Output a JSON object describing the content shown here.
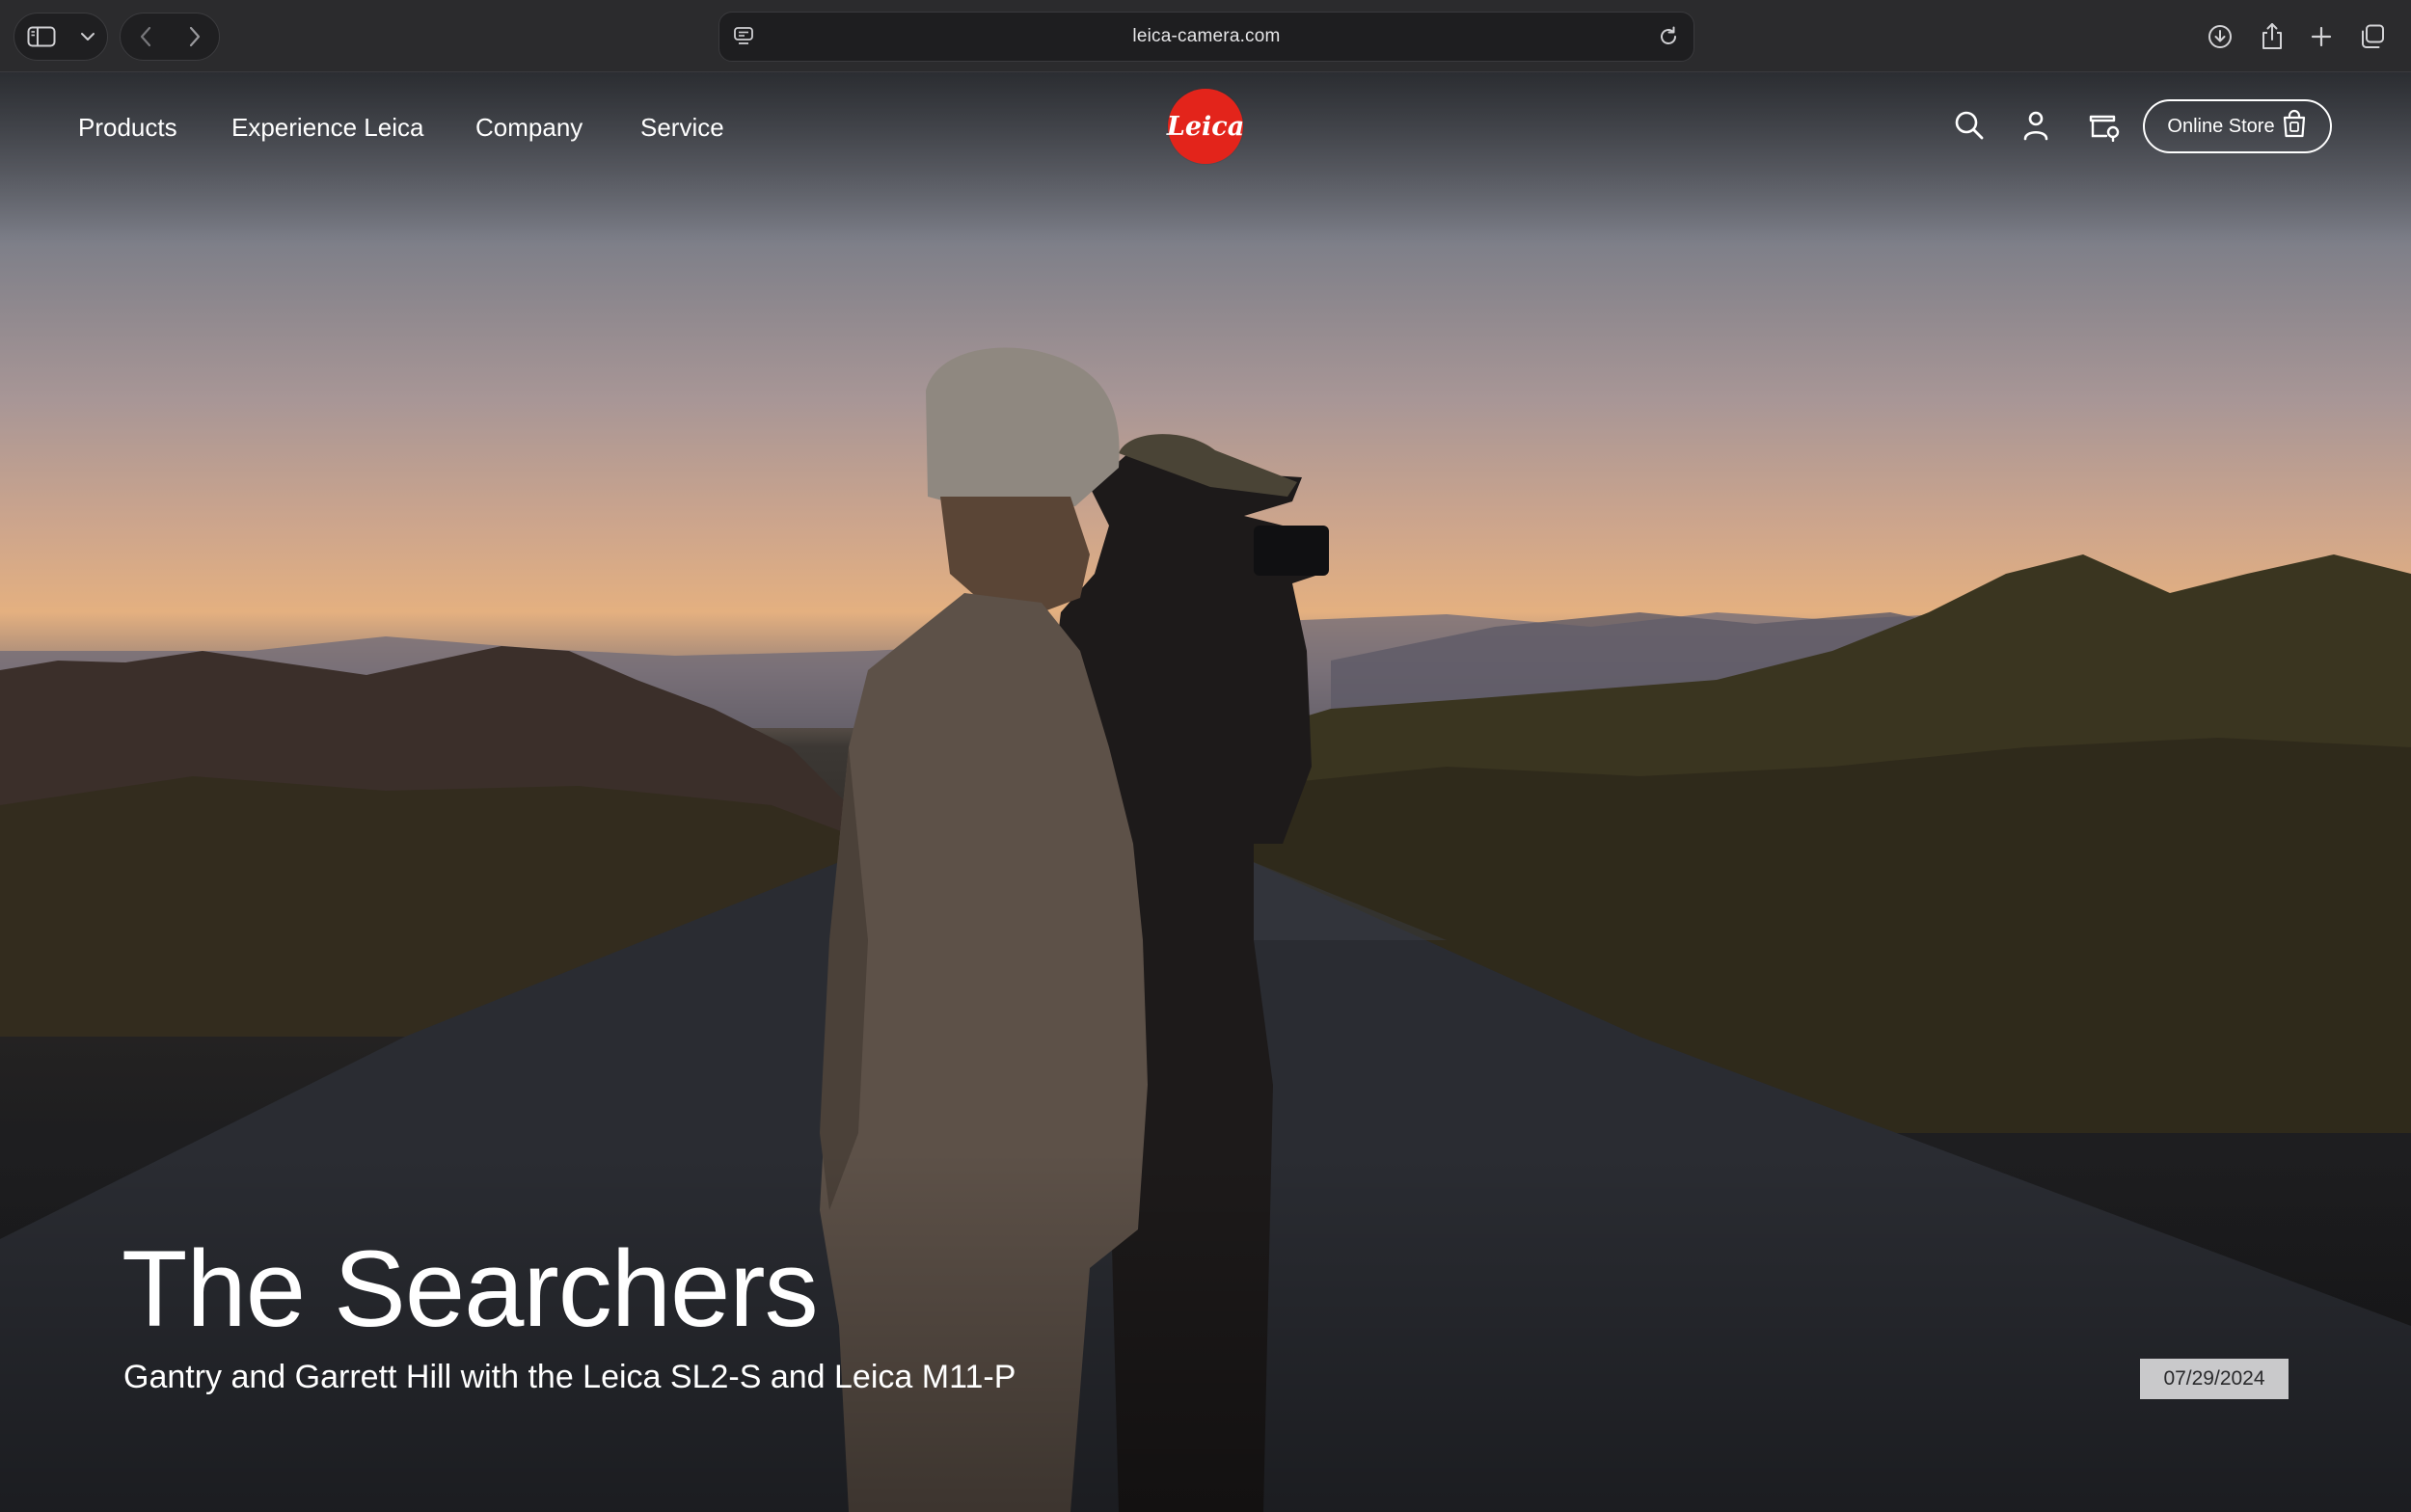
{
  "browser": {
    "url": "leica-camera.com",
    "icons": [
      "sidebar-icon",
      "chevron-down-icon",
      "back-icon",
      "forward-icon",
      "site-settings-icon",
      "reload-icon",
      "download-icon",
      "share-icon",
      "new-tab-icon",
      "tabs-overview-icon"
    ]
  },
  "site": {
    "logo_text": "Leica",
    "brand_color": "#e3241b",
    "nav": {
      "items": [
        {
          "label": "Products"
        },
        {
          "label": "Experience Leica"
        },
        {
          "label": "Company"
        },
        {
          "label": "Service"
        }
      ],
      "icons": [
        "search-icon",
        "account-icon",
        "dealer-locator-icon"
      ],
      "store_label": "Online Store",
      "store_icon": "shopping-bag-icon"
    },
    "hero": {
      "title": "The Searchers",
      "subtitle": "Gantry and Garrett Hill with the Leica SL2-S and Leica M11-P",
      "date": "07/29/2024"
    }
  }
}
